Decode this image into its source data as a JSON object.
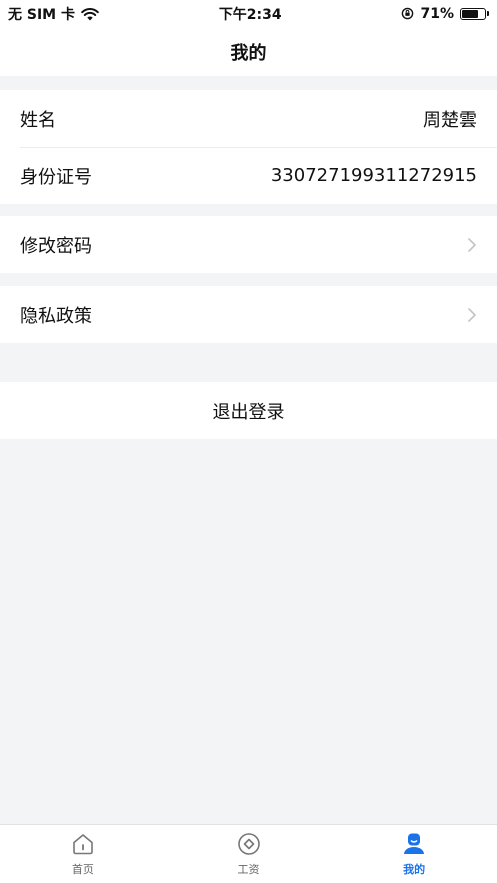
{
  "status_bar": {
    "carrier": "无 SIM 卡",
    "time": "下午2:34",
    "battery": "71%",
    "battery_level": 0.71
  },
  "header": {
    "title": "我的"
  },
  "profile": {
    "name_label": "姓名",
    "name_value": "周楚雲",
    "id_label": "身份证号",
    "id_value": "330727199311272915"
  },
  "menu": {
    "change_password": "修改密码",
    "privacy_policy": "隐私政策"
  },
  "logout_label": "退出登录",
  "tabs": [
    {
      "label": "首页",
      "icon": "home-icon",
      "active": false
    },
    {
      "label": "工资",
      "icon": "salary-icon",
      "active": false
    },
    {
      "label": "我的",
      "icon": "profile-icon",
      "active": true
    }
  ],
  "colors": {
    "accent": "#1a73e8",
    "background": "#f3f4f6"
  }
}
